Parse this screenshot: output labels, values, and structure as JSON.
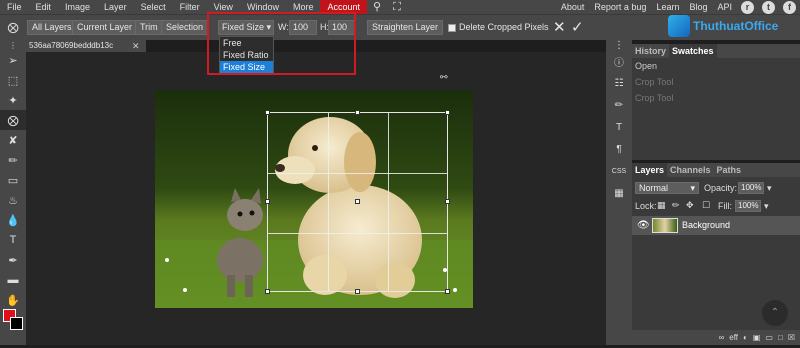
{
  "menu": {
    "items": [
      "File",
      "Edit",
      "Image",
      "Layer",
      "Select",
      "Filter",
      "View",
      "Window",
      "More",
      "Account"
    ],
    "active": "Account",
    "right_links": [
      "About",
      "Report a bug",
      "Learn",
      "Blog",
      "API"
    ]
  },
  "options": {
    "tabs": [
      "All Layers",
      "Current Layer",
      "Trim",
      "Selection"
    ],
    "crop_mode": "Fixed Size",
    "width_label": "W:",
    "width_value": "100",
    "height_label": "H:",
    "height_value": "100",
    "straighten": "Straighten Layer",
    "delete_cropped": "Delete Cropped Pixels"
  },
  "dropdown": {
    "options": [
      "Free",
      "Fixed Ratio",
      "Fixed Size"
    ],
    "selected": "Fixed Size"
  },
  "document": {
    "tab_name": "536aa78069bedddb13c"
  },
  "history": {
    "tabs": [
      "History",
      "Swatches"
    ],
    "rows": [
      "Open",
      "Crop Tool",
      "Crop Tool"
    ]
  },
  "layers": {
    "tabs": [
      "Layers",
      "Channels",
      "Paths"
    ],
    "blend_mode": "Normal",
    "opacity_label": "Opacity:",
    "opacity_value": "100%",
    "lock_label": "Lock:",
    "fill_label": "Fill:",
    "fill_value": "100%",
    "layer_name": "Background"
  },
  "footer": {
    "off_label": "eff"
  },
  "watermark": {
    "text": "ThuthuatOffice"
  },
  "colors": {
    "foreground": "#e0101a",
    "background": "#000000",
    "accent": "#c0141a",
    "selection": "#1e7fd8",
    "highlight_border": "#d11b22"
  }
}
